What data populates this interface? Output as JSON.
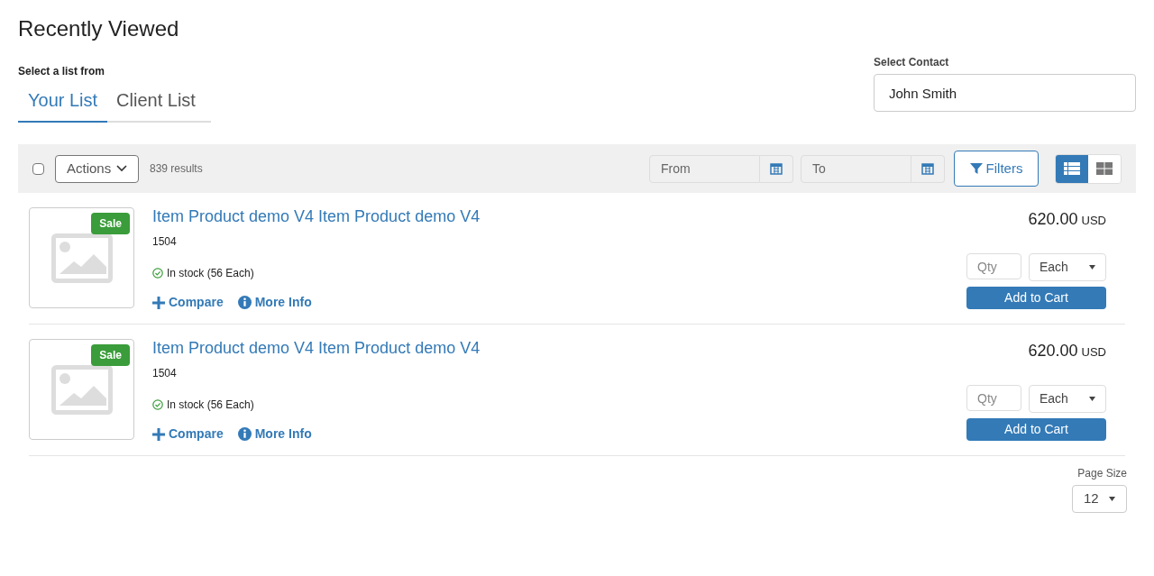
{
  "page_title": "Recently Viewed",
  "list_picker": {
    "label": "Select a list from",
    "tabs": [
      {
        "label": "Your List",
        "selected": true
      },
      {
        "label": "Client List",
        "selected": false
      }
    ]
  },
  "contact": {
    "label": "Select Contact",
    "value": "John Smith"
  },
  "toolbar": {
    "select_all": {
      "checked": false
    },
    "actions": "Actions",
    "results": "839 results",
    "from": {
      "placeholder": "From"
    },
    "to": {
      "placeholder": "To"
    },
    "filters": "Filters",
    "views": [
      {
        "kind": "list",
        "selected": true
      },
      {
        "kind": "grid",
        "selected": false
      }
    ]
  },
  "products": [
    {
      "badge": "Sale",
      "name": "Item Product demo V4 Item Product demo V4",
      "sku": "1504",
      "stock": "In stock (56 Each)",
      "compare": "Compare",
      "more_info": "More Info",
      "price": "620.00",
      "currency": "USD",
      "qty": {
        "placeholder": "Qty"
      },
      "unit": "Each",
      "add_to_cart": "Add to Cart"
    },
    {
      "badge": "Sale",
      "name": "Item Product demo V4 Item Product demo V4",
      "sku": "1504",
      "stock": "In stock (56 Each)",
      "compare": "Compare",
      "more_info": "More Info",
      "price": "620.00",
      "currency": "USD",
      "qty": {
        "placeholder": "Qty"
      },
      "unit": "Each",
      "add_to_cart": "Add to Cart"
    }
  ],
  "page_size": {
    "label": "Page Size",
    "value": "12"
  }
}
